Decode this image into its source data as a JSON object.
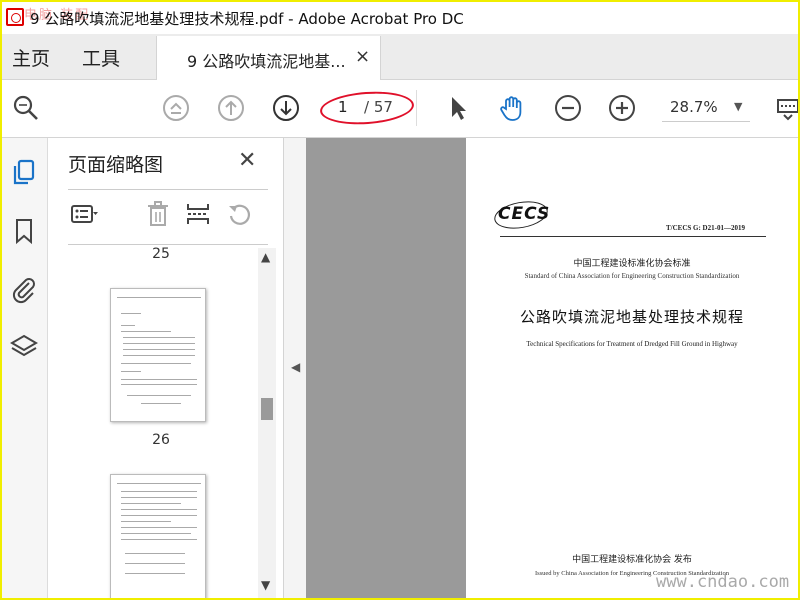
{
  "window": {
    "title": "9 公路吹填流泥地基处理技术规程.pdf - Adobe Acrobat Pro DC",
    "watermark_top_left": "电脑 装配",
    "watermark_bottom_right": "www.cndao.com"
  },
  "menu": {
    "home": "主页",
    "tools": "工具"
  },
  "tab": {
    "label": "9 公路吹填流泥地基...",
    "close": "×"
  },
  "toolbar": {
    "page_current": "1",
    "page_total": "/ 57",
    "zoom": "28.7%",
    "zoom_arrow": "▼"
  },
  "thumbnail_panel": {
    "title": "页面缩略图",
    "close": "✕",
    "pages": [
      {
        "label": "25"
      },
      {
        "label": "26"
      }
    ]
  },
  "document": {
    "logo_text": "CECS",
    "standard_code": "T/CECS G: D21-01—2019",
    "org_cn": "中国工程建设标准化协会标准",
    "org_en": "Standard of China Association for Engineering Construction Standardization",
    "title_cn": "公路吹填流泥地基处理技术规程",
    "title_en": "Technical Specifications for Treatment of Dredged Fill Ground in Highway",
    "publisher_cn": "中国工程建设标准化协会 发布",
    "publisher_en": "Issued by China Association for Engineering Construction Standardization"
  },
  "colors": {
    "frame": "#f0ee00",
    "accent_blue": "#1a73c8",
    "annotation_red": "#e0102a"
  }
}
